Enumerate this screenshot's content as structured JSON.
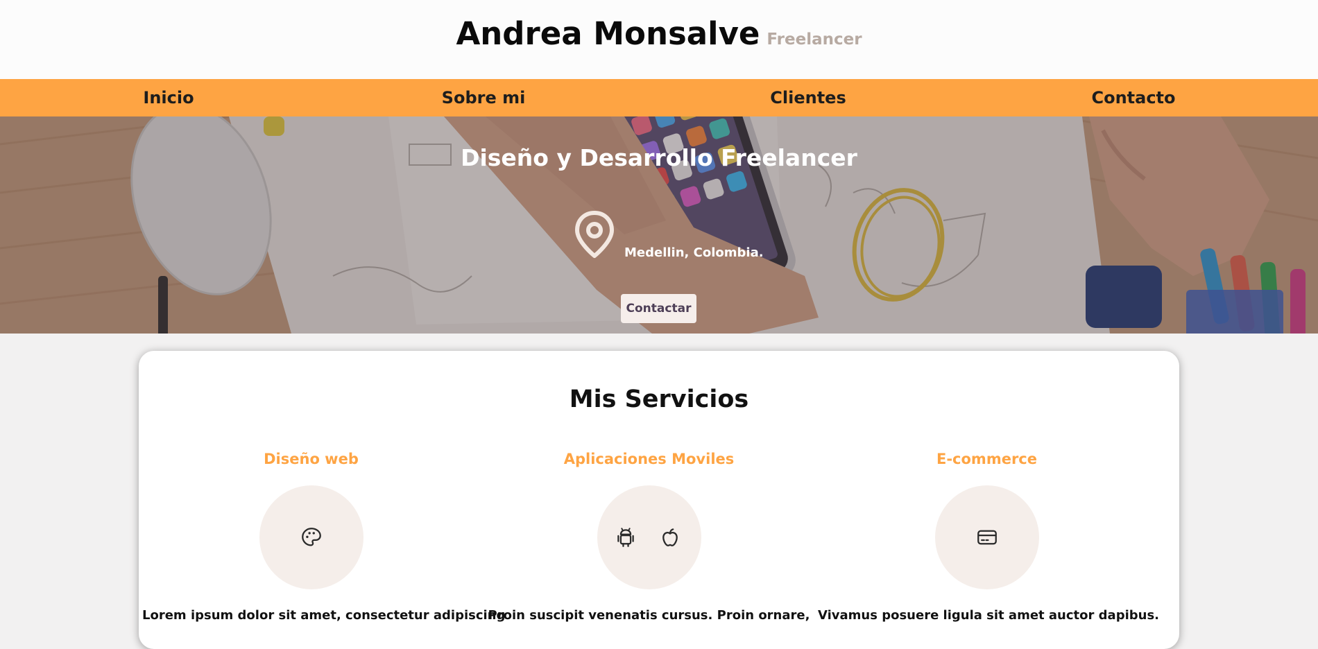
{
  "header": {
    "name": "Andrea Monsalve",
    "tagline": "Freelancer"
  },
  "nav": {
    "items": [
      {
        "label": "Inicio"
      },
      {
        "label": "Sobre mi"
      },
      {
        "label": "Clientes"
      },
      {
        "label": "Contacto"
      }
    ]
  },
  "hero": {
    "title": "Diseño y Desarrollo Freelancer",
    "location": "Medellin, Colombia.",
    "location_icon": "map-pin-icon",
    "cta_label": "Contactar"
  },
  "services": {
    "title": "Mis Servicios",
    "items": [
      {
        "name": "Diseño web",
        "icons": [
          "palette-icon"
        ],
        "description": "Lorem ipsum dolor sit amet, consectetur adipiscing"
      },
      {
        "name": "Aplicaciones Moviles",
        "icons": [
          "android-icon",
          "apple-icon"
        ],
        "description": "Proin suscipit venenatis cursus. Proin ornare,"
      },
      {
        "name": "E-commerce",
        "icons": [
          "credit-card-icon"
        ],
        "description": "Vivamus posuere ligula sit amet auctor dapibus."
      }
    ]
  },
  "colors": {
    "accent": "#fea443",
    "header_bg": "#fcfcfc",
    "page_bg": "#f2f1f1",
    "tagline": "#b7aaa2",
    "icon_circle": "#f5eeea",
    "button_bg": "#f6eeeb",
    "button_text": "#4e3f57"
  }
}
